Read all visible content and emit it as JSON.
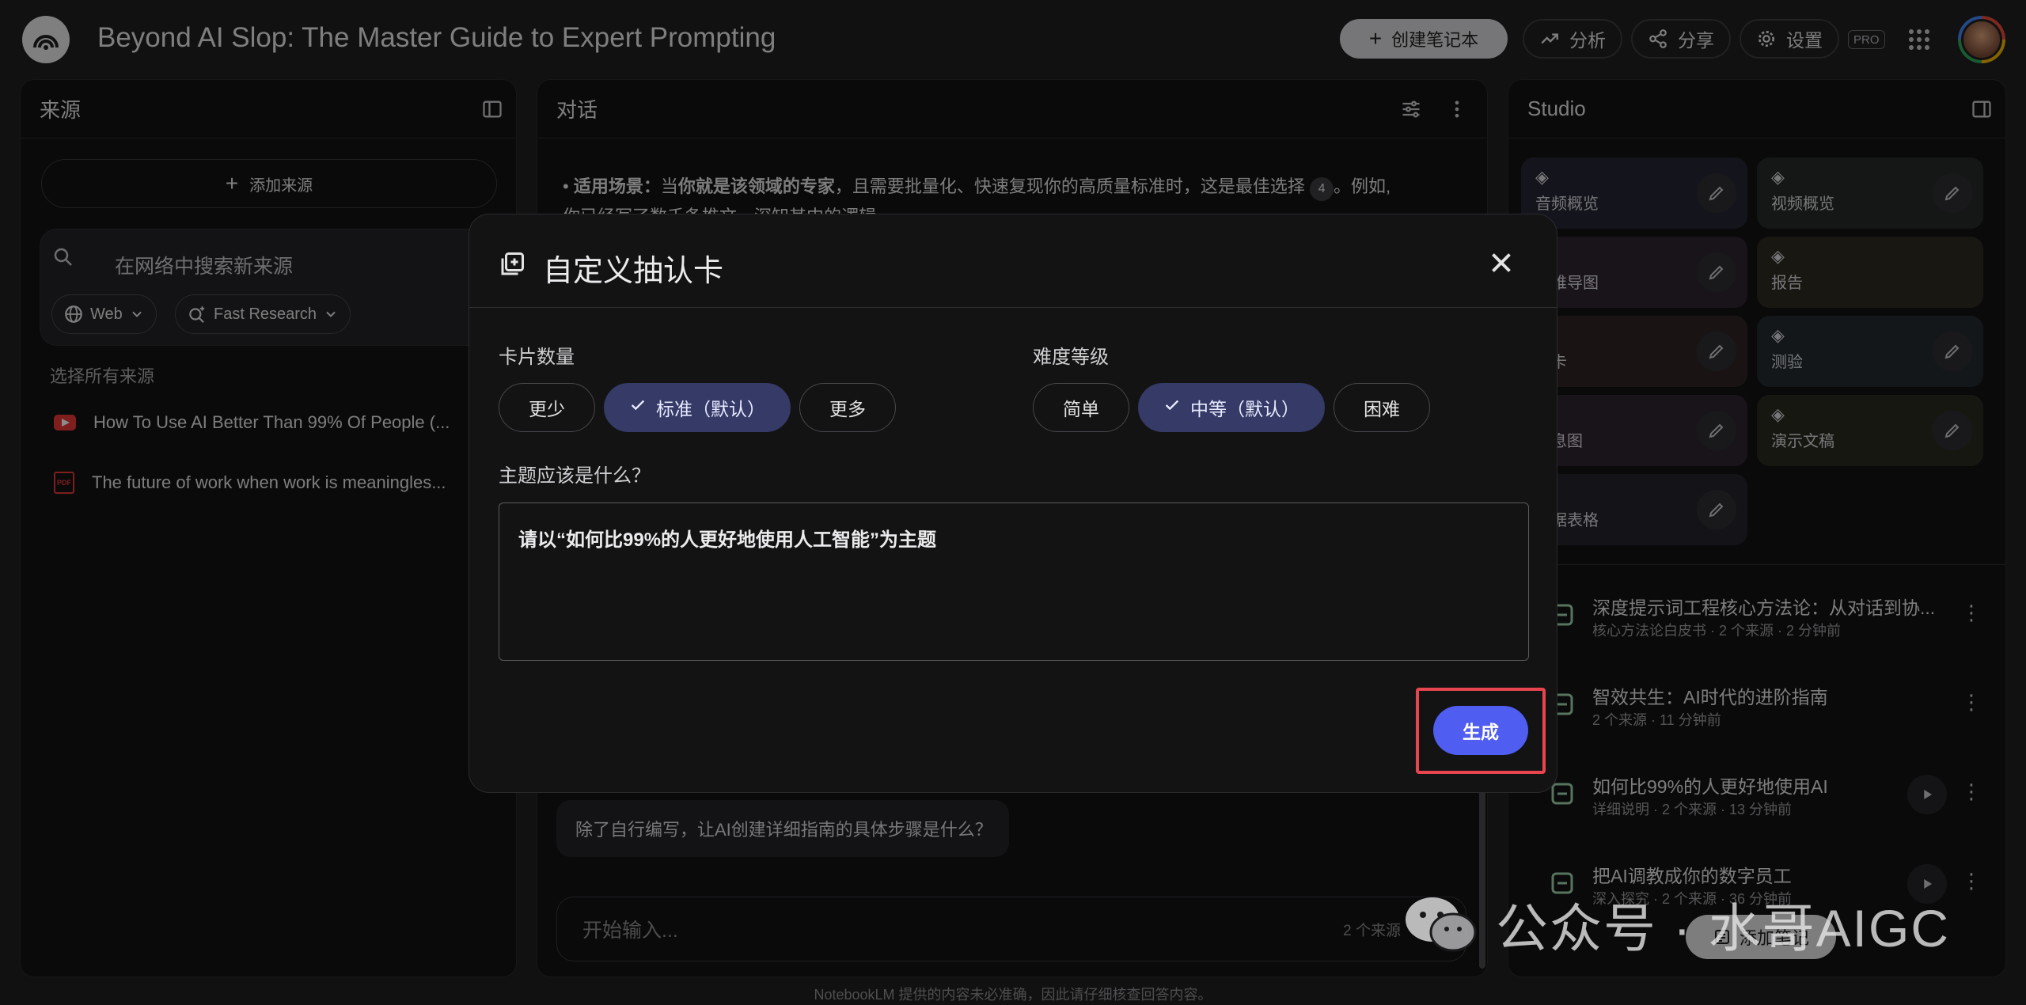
{
  "header": {
    "title": "Beyond AI Slop: The Master Guide to Expert Prompting",
    "create_notebook": "创建笔记本",
    "analytics": "分析",
    "share": "分享",
    "settings": "设置",
    "pro_badge": "PRO"
  },
  "sources": {
    "title": "来源",
    "add_source": "添加来源",
    "search_placeholder": "在网络中搜索新来源",
    "chip_web": "Web",
    "chip_research": "Fast Research",
    "select_all": "选择所有来源",
    "items": [
      {
        "label": "How To Use AI Better Than 99% Of People (...",
        "icon": "youtube-icon"
      },
      {
        "label": "The future of work when work is meaningles...",
        "icon": "pdf-icon"
      }
    ]
  },
  "chat": {
    "title": "对话",
    "text_prefix": "• ",
    "text_bold1": "适用场景：",
    "text_mid1": "当",
    "text_bold2": "你就是该领域的专家",
    "text_mid2": "，且需要批量化、快速复现你的高质量标准时，这是最佳选择",
    "cite": "4",
    "text_end": "。例如,",
    "text_line2": "你已经写了数千条推文，深知其中的逻辑。",
    "suggestion": "除了自行编写，让AI创建详细指南的具体步骤是什么？",
    "input_placeholder": "开始输入...",
    "source_count": "2 个来源"
  },
  "studio": {
    "title": "Studio",
    "tiles": [
      {
        "label": "音频概览",
        "icon": "audio-wave-icon",
        "bg": "#252633"
      },
      {
        "label": "视频概览",
        "icon": "video-icon",
        "bg": "#252b27"
      },
      {
        "label": "思维导图",
        "icon": "mindmap-icon",
        "bg": "#2e2430"
      },
      {
        "label": "报告",
        "icon": "report-icon",
        "bg": "#2c2b22"
      },
      {
        "label": "闪卡",
        "icon": "flashcard-icon",
        "bg": "#2e2624"
      },
      {
        "label": "测验",
        "icon": "quiz-icon",
        "bg": "#232a30"
      },
      {
        "label": "信息图",
        "icon": "infographic-icon",
        "bg": "#2e2430"
      },
      {
        "label": "演示文稿",
        "icon": "slides-icon",
        "bg": "#2b2a22"
      },
      {
        "label": "数据表格",
        "icon": "table-icon",
        "bg": "#26262d"
      }
    ],
    "notes": [
      {
        "title": "深度提示词工程核心方法论：从对话到协...",
        "sub": "核心方法论白皮书 · 2 个来源 · 2 分钟前",
        "icon": "report-icon"
      },
      {
        "title": "智效共生：AI时代的进阶指南",
        "sub": "2 个来源 · 11 分钟前",
        "icon": "mindmap-icon"
      },
      {
        "title": "如何比99%的人更好地使用AI",
        "sub": "详细说明 · 2 个来源 · 13 分钟前",
        "icon": "video-icon"
      },
      {
        "title": "把AI调教成你的数字员工",
        "sub": "深入探究 · 2 个来源 · 36 分钟前",
        "icon": "audio-wave-icon"
      }
    ],
    "add_note": "添加笔记"
  },
  "modal": {
    "title": "自定义抽认卡",
    "count_label": "卡片数量",
    "count_options": [
      "更少",
      "标准（默认）",
      "更多"
    ],
    "count_selected": 1,
    "difficulty_label": "难度等级",
    "difficulty_options": [
      "简单",
      "中等（默认）",
      "困难"
    ],
    "difficulty_selected": 1,
    "topic_label": "主题应该是什么？",
    "topic_value": "请以“如何比99%的人更好地使用人工智能”为主题",
    "generate": "生成"
  },
  "footer": {
    "disclaimer": "NotebookLM 提供的内容未必准确，因此请仔细核查回答内容。"
  },
  "watermark": {
    "text": "公众号 · 水哥AIGC"
  },
  "colors": {
    "accent": "#4f5df0",
    "selected_chip": "#353a66",
    "highlight_box": "#e8454f"
  }
}
